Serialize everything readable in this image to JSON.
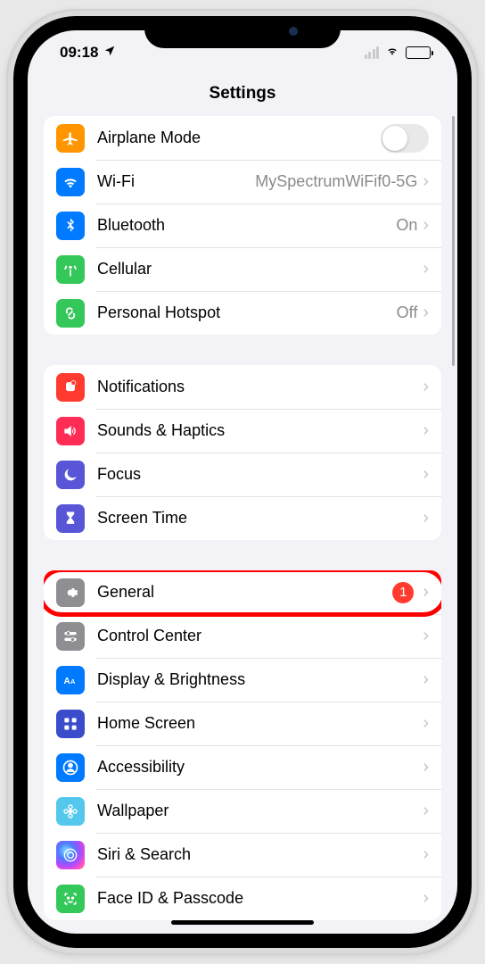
{
  "status": {
    "time": "09:18"
  },
  "header": {
    "title": "Settings"
  },
  "sections": [
    {
      "rows": [
        {
          "id": "airplane",
          "label": "Airplane Mode",
          "color": "#ff9500",
          "iconShape": "plane",
          "toggle": true
        },
        {
          "id": "wifi",
          "label": "Wi-Fi",
          "value": "MySpectrumWiFif0-5G",
          "color": "#007aff",
          "iconShape": "wifi",
          "disclosure": true
        },
        {
          "id": "bluetooth",
          "label": "Bluetooth",
          "value": "On",
          "color": "#007aff",
          "iconShape": "bluetooth",
          "disclosure": true
        },
        {
          "id": "cellular",
          "label": "Cellular",
          "color": "#34c759",
          "iconShape": "antenna",
          "disclosure": true
        },
        {
          "id": "hotspot",
          "label": "Personal Hotspot",
          "value": "Off",
          "color": "#34c759",
          "iconShape": "link",
          "disclosure": true
        }
      ]
    },
    {
      "rows": [
        {
          "id": "notifications",
          "label": "Notifications",
          "color": "#ff3b30",
          "iconShape": "bell",
          "disclosure": true
        },
        {
          "id": "sounds",
          "label": "Sounds & Haptics",
          "color": "#ff2d55",
          "iconShape": "speaker",
          "disclosure": true
        },
        {
          "id": "focus",
          "label": "Focus",
          "color": "#5856d6",
          "iconShape": "moon",
          "disclosure": true
        },
        {
          "id": "screentime",
          "label": "Screen Time",
          "color": "#5856d6",
          "iconShape": "hourglass",
          "disclosure": true
        }
      ]
    },
    {
      "rows": [
        {
          "id": "general",
          "label": "General",
          "color": "#8e8e93",
          "iconShape": "gear",
          "badge": "1",
          "disclosure": true,
          "highlighted": true
        },
        {
          "id": "controlcenter",
          "label": "Control Center",
          "color": "#8e8e93",
          "iconShape": "sliders",
          "disclosure": true
        },
        {
          "id": "display",
          "label": "Display & Brightness",
          "color": "#007aff",
          "iconShape": "aa",
          "disclosure": true
        },
        {
          "id": "homescreen",
          "label": "Home Screen",
          "color": "#3b4cca",
          "iconShape": "grid",
          "disclosure": true
        },
        {
          "id": "accessibility",
          "label": "Accessibility",
          "color": "#007aff",
          "iconShape": "person",
          "disclosure": true
        },
        {
          "id": "wallpaper",
          "label": "Wallpaper",
          "color": "#54c7ec",
          "iconShape": "flower",
          "disclosure": true
        },
        {
          "id": "siri",
          "label": "Siri & Search",
          "color": "siri",
          "iconShape": "siri",
          "disclosure": true
        },
        {
          "id": "faceid",
          "label": "Face ID & Passcode",
          "color": "#34c759",
          "iconShape": "face",
          "disclosure": true
        }
      ]
    }
  ]
}
